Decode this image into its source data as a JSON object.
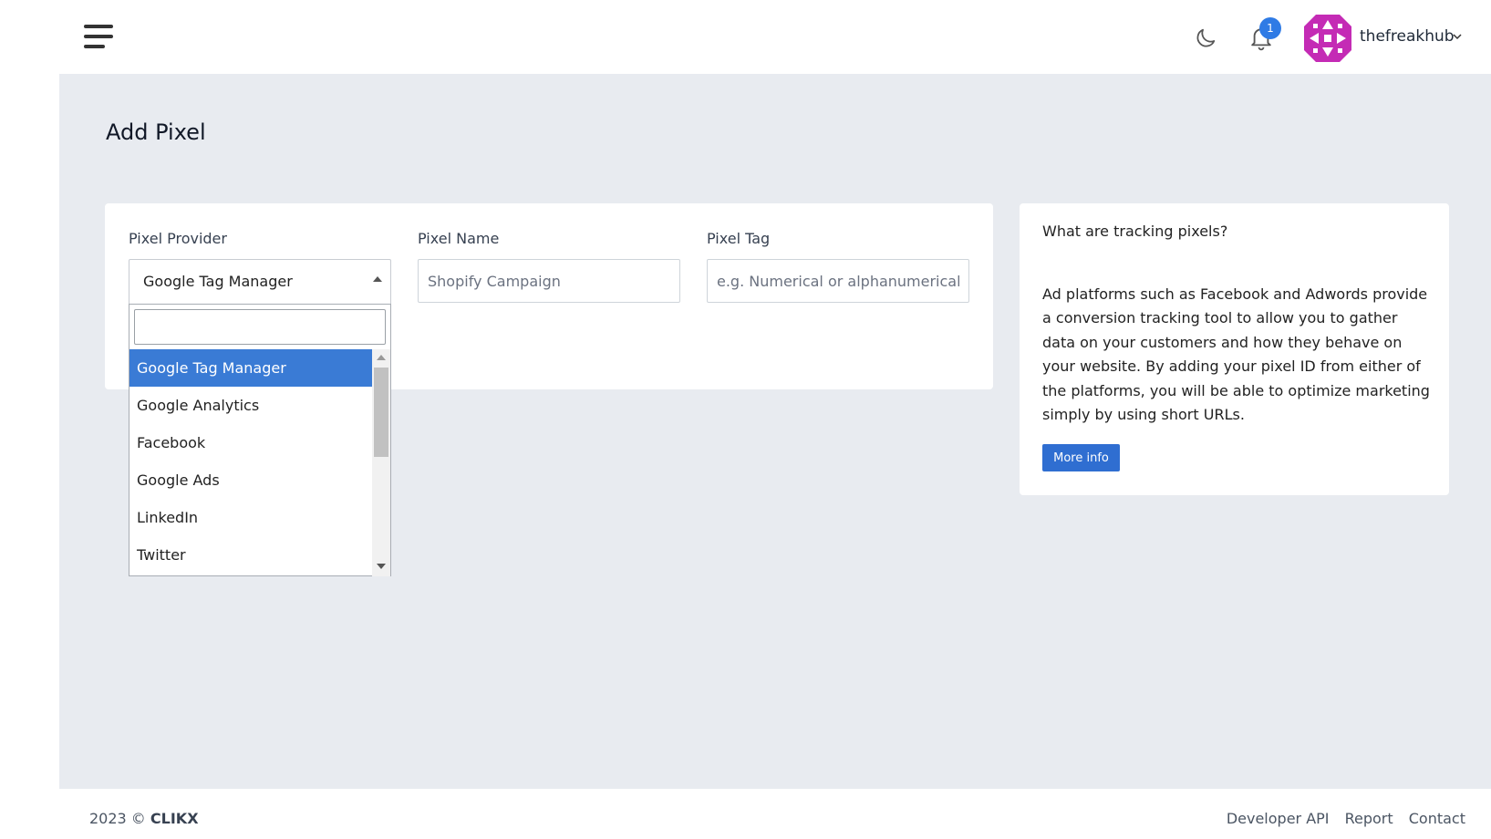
{
  "header": {
    "username": "thefreakhub",
    "notification_count": "1",
    "icons": {
      "menu": "hamburger-menu-icon",
      "theme": "moon-icon",
      "notifications": "bell-icon",
      "avatar": "user-avatar",
      "dropdown": "chevron-down-icon"
    },
    "avatar_color": "#c42bb5"
  },
  "page": {
    "title": "Add Pixel"
  },
  "form": {
    "provider": {
      "label": "Pixel Provider",
      "selected": "Google Tag Manager",
      "options": [
        "Google Tag Manager",
        "Google Analytics",
        "Facebook",
        "Google Ads",
        "LinkedIn",
        "Twitter"
      ]
    },
    "name": {
      "label": "Pixel Name",
      "placeholder": "Shopify Campaign"
    },
    "tag": {
      "label": "Pixel Tag",
      "placeholder": "e.g. Numerical or alphanumerical value"
    }
  },
  "info": {
    "title": "What are tracking pixels?",
    "text": "Ad platforms such as Facebook and Adwords provide a conversion tracking tool to allow you to gather data on your customers and how they behave on your website. By adding your pixel ID from either of the platforms, you will be able to optimize marketing simply by using short URLs.",
    "button": "More info"
  },
  "footer": {
    "year": "2023 ©",
    "brand": "CLIKX",
    "links": [
      "Developer API",
      "Report",
      "Contact"
    ]
  },
  "colors": {
    "accent": "#2f6ed1",
    "selected_option": "#3a7bd5",
    "badge": "#2f7be5",
    "background": "#e8ebf0"
  }
}
